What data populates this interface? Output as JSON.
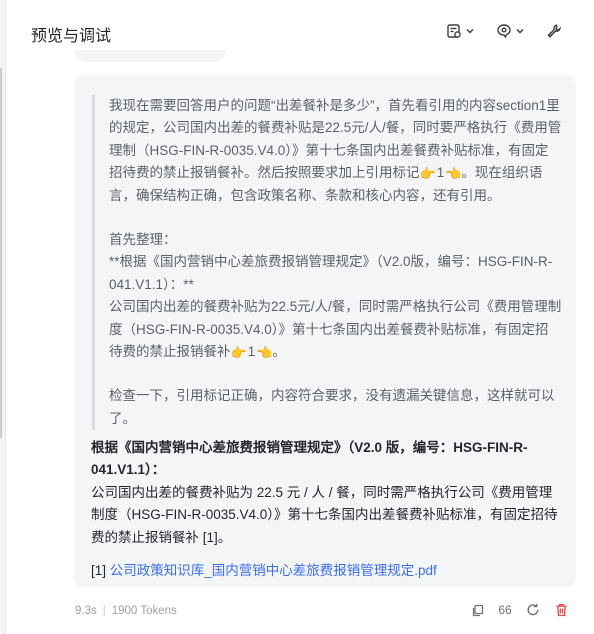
{
  "header": {
    "title": "预览与调试"
  },
  "thinking": {
    "para1_a": "我现在需要回答用户的问题“出差餐补是多少”，首先看引用的内容section1里的规定，公司国内出差的餐费补贴是22.5元/人/餐，同时要严格执行《费用管理制（HSG-FIN-R-0035.V4.0）》第十七条国内出差餐费补贴标准，有固定招待费的禁止报销餐补。然后按照要求加上引用标记",
    "para1_cite": "1",
    "para1_b": "。现在组织语言，确保结构正确，包含政策名称、条款和核心内容，还有引用。",
    "para2_line1": "首先整理：",
    "para2_line2": "**根据《国内营销中心差旅费报销管理规定》（V2.0版，编号：HSG-FIN-R-041.V1.1）：**",
    "para2_line3": "公司国内出差的餐费补贴为22.5元/人/餐，同时需严格执行公司《费用管理制度（HSG-FIN-R-0035.V4.0）》第十七条国内出差餐费补贴标准，有固定招待费的禁止报销餐补",
    "para2_cite": "1",
    "para2_end": "。",
    "para3": "检查一下，引用标记正确，内容符合要求，没有遗漏关键信息，这样就可以了。"
  },
  "answer": {
    "heading": "根据《国内营销中心差旅费报销管理规定》（V2.0 版，编号：HSG-FIN-R-041.V1.1）：",
    "body": "公司国内出差的餐费补贴为 22.5 元 / 人 / 餐，同时需严格执行公司《费用管理制度（HSG-FIN-R-0035.V4.0）》第十七条国内出差餐费补贴标准，有固定招待费的禁止报销餐补 [1]。",
    "ref_index": "[1]",
    "ref_link": "公司政策知识库_国内营销中心差旅费报销管理规定.pdf"
  },
  "footer": {
    "time": "9.3s",
    "tokens": "1900 Tokens",
    "quote_label": "66"
  },
  "icons": {
    "settings": "debug-settings-icon",
    "model": "model-select-icon",
    "tools": "wrench-icon",
    "hand_right": "pointing-hand-right-icon",
    "hand_left": "pointing-hand-left-icon",
    "copy": "copy-icon",
    "quote": "quote-icon",
    "refresh": "refresh-icon",
    "delete": "delete-icon"
  },
  "colors": {
    "link": "#3a6ef2",
    "delete": "#e5484d",
    "bubble_bg": "#f4f5f7"
  }
}
